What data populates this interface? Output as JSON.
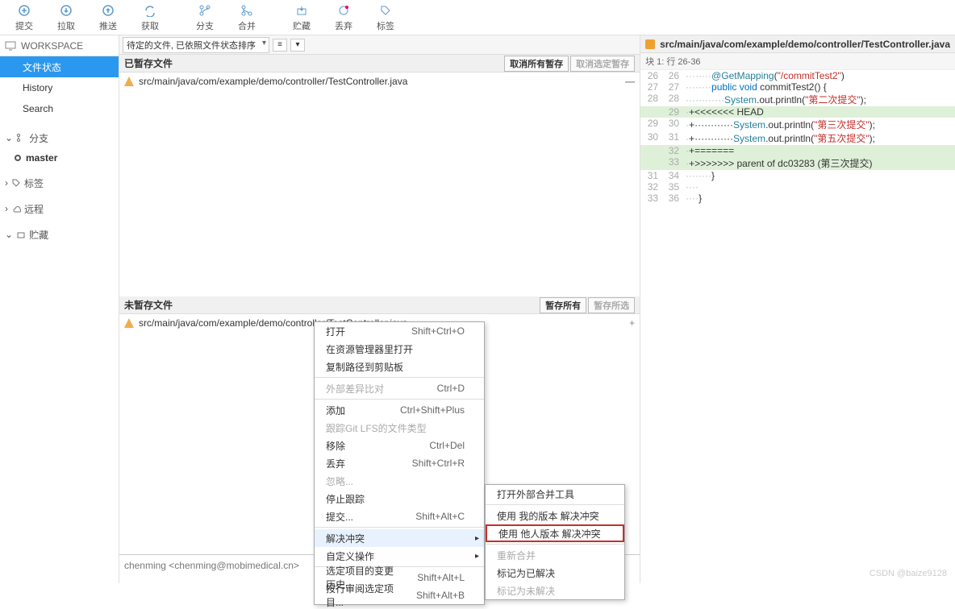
{
  "toolbar": [
    {
      "name": "commit",
      "label": "提交"
    },
    {
      "name": "pull",
      "label": "拉取"
    },
    {
      "name": "push",
      "label": "推送"
    },
    {
      "name": "fetch",
      "label": "获取"
    },
    {
      "name": "branch",
      "label": "分支"
    },
    {
      "name": "merge",
      "label": "合并"
    },
    {
      "name": "stash",
      "label": "贮藏"
    },
    {
      "name": "discard",
      "label": "丢弃"
    },
    {
      "name": "tag",
      "label": "标签"
    }
  ],
  "sidebar": {
    "workspace": "WORKSPACE",
    "items": [
      "文件状态",
      "History",
      "Search"
    ],
    "branch_header": "分支",
    "branches": [
      "master"
    ],
    "tags": "标签",
    "remotes": "远程",
    "stashes": "贮藏"
  },
  "filter": {
    "sort": "待定的文件, 已依照文件状态排序"
  },
  "staged": {
    "title": "已暂存文件",
    "btn1": "取消所有暂存",
    "btn2": "取消选定暂存",
    "file": "src/main/java/com/example/demo/controller/TestController.java"
  },
  "unstaged": {
    "title": "未暂存文件",
    "btn1": "暂存所有",
    "btn2": "暂存所选",
    "file": "src/main/java/com/example/demo/controller/TestController.java"
  },
  "commit_author": "chenming <chenming@mobimedical.cn>",
  "diff": {
    "file": "src/main/java/com/example/demo/controller/TestController.java",
    "hunk": "块 1: 行 26-36",
    "rows": [
      {
        "a": "26",
        "b": "26",
        "cls": "",
        "pre": "········",
        "html": "<span class='anno'>@GetMapping</span>(<span class='str'>\"/commitTest2\"</span>)"
      },
      {
        "a": "27",
        "b": "27",
        "cls": "",
        "pre": "········",
        "html": "<span class='kw-blue'>public</span> <span class='kw-blue'>void</span> commitTest2() {"
      },
      {
        "a": "28",
        "b": "28",
        "cls": "",
        "pre": "············",
        "html": "<span class='kw-teal'>System</span>.out.println(<span class='str'>\"第二次提交\"</span>);"
      },
      {
        "a": "",
        "b": "29",
        "cls": "add",
        "pre": "·",
        "html": "+<<<<<<< HEAD"
      },
      {
        "a": "29",
        "b": "30",
        "cls": "",
        "pre": "·",
        "html": "+············<span class='kw-teal'>System</span>.out.println(<span class='str'>\"第三次提交\"</span>);"
      },
      {
        "a": "30",
        "b": "31",
        "cls": "",
        "pre": "·",
        "html": "+············<span class='kw-teal'>System</span>.out.println(<span class='str'>\"第五次提交\"</span>);"
      },
      {
        "a": "",
        "b": "32",
        "cls": "add",
        "pre": "·",
        "html": "+======="
      },
      {
        "a": "",
        "b": "33",
        "cls": "add",
        "pre": "·",
        "html": "+>>>>>>> parent of dc03283 (第三次提交)"
      },
      {
        "a": "31",
        "b": "34",
        "cls": "",
        "pre": "········",
        "html": "}"
      },
      {
        "a": "32",
        "b": "35",
        "cls": "",
        "pre": "····",
        "html": ""
      },
      {
        "a": "33",
        "b": "36",
        "cls": "",
        "pre": "····",
        "html": "}"
      }
    ]
  },
  "ctx1": [
    {
      "t": "打开",
      "s": "Shift+Ctrl+O"
    },
    {
      "t": "在资源管理器里打开"
    },
    {
      "t": "复制路径到剪贴板"
    },
    {
      "sep": true
    },
    {
      "t": "外部差异比对",
      "s": "Ctrl+D",
      "dis": true
    },
    {
      "sep": true
    },
    {
      "t": "添加",
      "s": "Ctrl+Shift+Plus"
    },
    {
      "t": "跟踪Git LFS的文件类型",
      "dis": true
    },
    {
      "t": "移除",
      "s": "Ctrl+Del"
    },
    {
      "t": "丢弃",
      "s": "Shift+Ctrl+R"
    },
    {
      "t": "忽略...",
      "dis": true
    },
    {
      "t": "停止跟踪"
    },
    {
      "t": "提交...",
      "s": "Shift+Alt+C"
    },
    {
      "sep": true
    },
    {
      "t": "解决冲突",
      "sub": true,
      "hl": true
    },
    {
      "t": "自定义操作",
      "sub": true
    },
    {
      "sep": true
    },
    {
      "t": "选定项目的变更历史...",
      "s": "Shift+Alt+L"
    },
    {
      "t": "按行审阅选定项目...",
      "s": "Shift+Alt+B"
    }
  ],
  "ctx2": [
    {
      "t": "打开外部合并工具"
    },
    {
      "sep": true
    },
    {
      "t": "使用 我的版本 解决冲突"
    },
    {
      "t": "使用 他人版本 解决冲突",
      "outline": true
    },
    {
      "sep": true
    },
    {
      "t": "重新合并",
      "dis": true
    },
    {
      "t": "标记为已解决"
    },
    {
      "t": "标记为未解决",
      "dis": true
    }
  ],
  "watermark": "CSDN @baize9128"
}
